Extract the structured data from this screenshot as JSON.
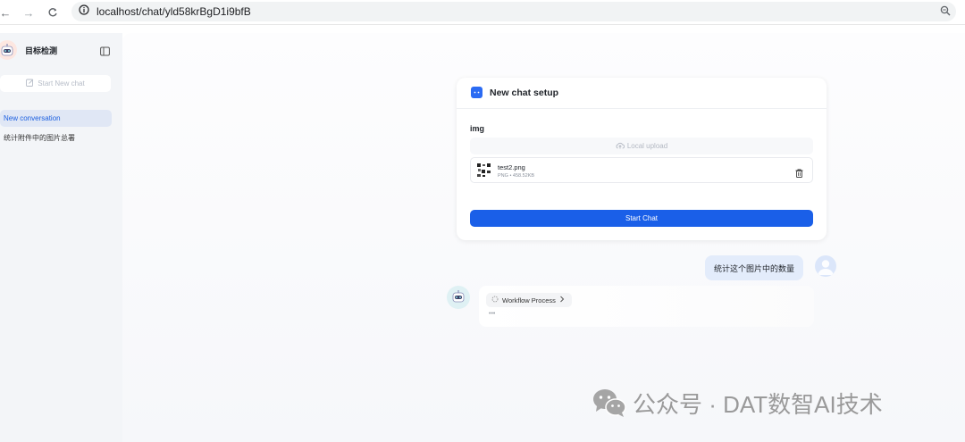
{
  "browser": {
    "url": "localhost/chat/yld58krBgD1i9bfB",
    "icons": [
      "back-icon",
      "forward-icon",
      "reload-icon",
      "site-info-icon",
      "zoom-icon"
    ]
  },
  "sidebar": {
    "app_title": "目标检测",
    "new_chat_label": "Start New chat",
    "items": [
      {
        "label": "New conversation",
        "active": true
      },
      {
        "label": "统计附件中的图片总署",
        "active": false
      }
    ]
  },
  "setup": {
    "title": "New chat setup",
    "field_label": "img",
    "upload_label": "Local upload",
    "file": {
      "name": "test2.png",
      "meta": "PNG • 458.52KB"
    },
    "start_label": "Start Chat"
  },
  "chat": {
    "user_message": "统计这个图片中的数量",
    "workflow_label": "Workflow Process",
    "typing": "•••"
  },
  "watermark": "公众号 · DAT数智AI技术",
  "colors": {
    "accent": "#1a5fe8",
    "sidebar_bg": "#f3f5f8",
    "active_item_bg": "#e0e7f5"
  }
}
